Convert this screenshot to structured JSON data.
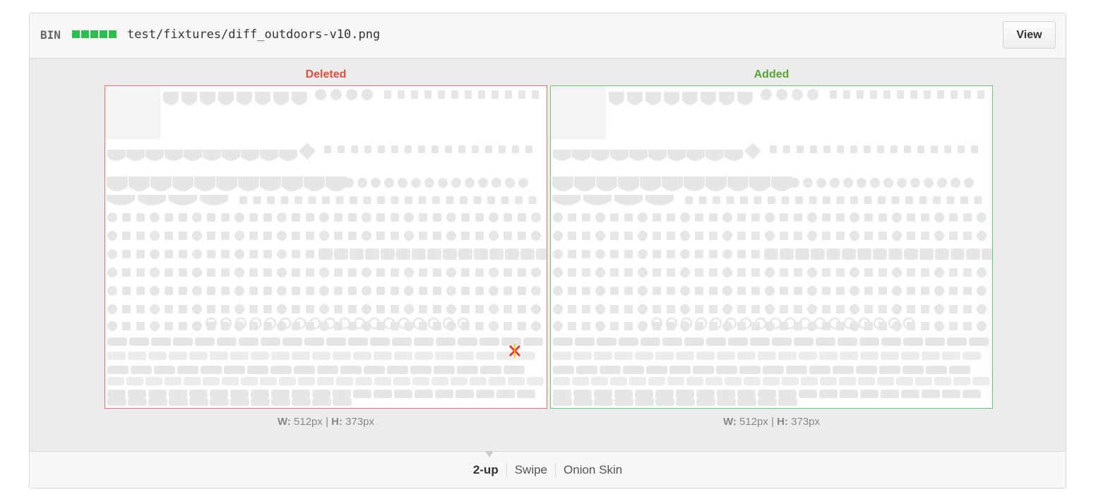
{
  "header": {
    "bin_label": "BIN",
    "file_path": "test/fixtures/diff_outdoors-v10.png",
    "view_button": "View",
    "diffstat_color": "#2cbe4e"
  },
  "deleted": {
    "label": "Deleted",
    "width_label": "W:",
    "width_value": "512px",
    "height_label": "H:",
    "height_value": "373px",
    "border_color": "#e57373"
  },
  "added": {
    "label": "Added",
    "width_label": "W:",
    "width_value": "512px",
    "height_label": "H:",
    "height_value": "373px",
    "border_color": "#6cc56c"
  },
  "separator": "|",
  "modes": {
    "two_up": "2-up",
    "swipe": "Swipe",
    "onion_skin": "Onion Skin"
  },
  "changed_marker_icon": "red-x-icon"
}
